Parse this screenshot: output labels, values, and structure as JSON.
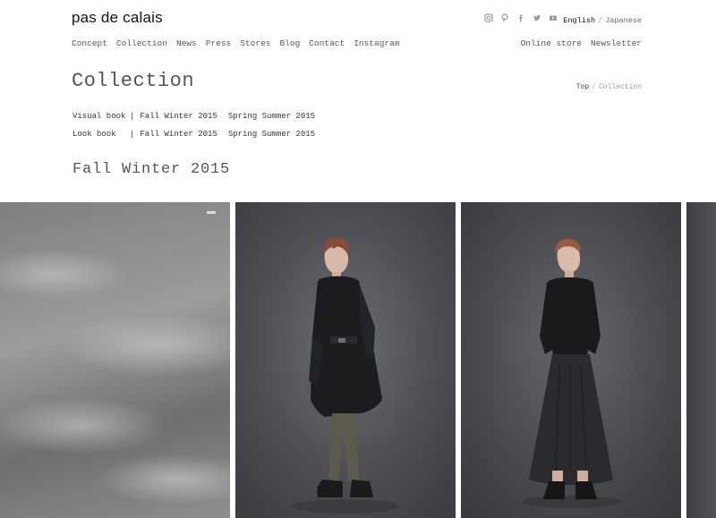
{
  "brand": {
    "logo": "pas de calais"
  },
  "social_icons": [
    "instagram-icon",
    "pinterest-icon",
    "facebook-icon",
    "twitter-icon",
    "youtube-icon"
  ],
  "language": {
    "active": "English",
    "separator": "/",
    "other": "Japanese"
  },
  "nav": {
    "main": [
      "Concept",
      "Collection",
      "News",
      "Press",
      "Stores",
      "Blog",
      "Contact",
      "Instagram"
    ],
    "secondary": [
      "Online store",
      "Newsletter"
    ]
  },
  "page": {
    "title": "Collection"
  },
  "breadcrumb": {
    "top": "Top",
    "separator": "/",
    "current": "Collection"
  },
  "books": [
    {
      "label": "Visual book",
      "links": [
        "Fall Winter 2015",
        "Spring Summer 2015"
      ]
    },
    {
      "label": "Look book",
      "links": [
        "Fall Winter 2015",
        "Spring Summer 2015"
      ]
    }
  ],
  "section": {
    "title": "Fall Winter 2015"
  },
  "colors": {
    "background": "#ffffff",
    "text": "#333333",
    "muted": "#999999",
    "studio_backdrop": "#4a4c51"
  }
}
